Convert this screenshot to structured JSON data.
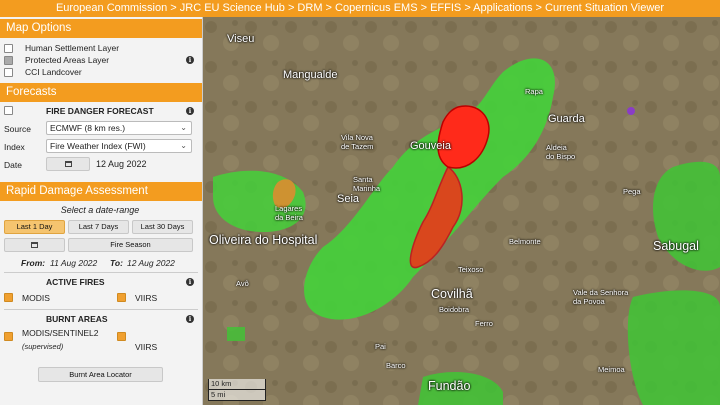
{
  "breadcrumb": "European Commission > JRC EU Science Hub > DRM > Copernicus EMS > EFFIS > Applications > Current Situation Viewer",
  "map_options": {
    "title": "Map Options",
    "layers": [
      {
        "label": "Human Settlement Layer"
      },
      {
        "label": "Protected Areas Layer"
      },
      {
        "label": "CCI Landcover"
      }
    ]
  },
  "forecasts": {
    "title": "Forecasts",
    "fire_danger_label": "FIRE DANGER FORECAST",
    "source_label": "Source",
    "source_value": "ECMWF (8 km res.)",
    "index_label": "Index",
    "index_value": "Fire Weather Index (FWI)",
    "date_label": "Date",
    "date_value": "12 Aug 2022"
  },
  "rapid": {
    "title": "Rapid Damage Assessment",
    "select_range": "Select a date-range",
    "btn_1day": "Last 1 Day",
    "btn_7days": "Last 7 Days",
    "btn_30days": "Last 30 Days",
    "btn_season": "Fire Season",
    "from_label": "From:",
    "from_value": "11 Aug 2022",
    "to_label": "To:",
    "to_value": "12 Aug 2022",
    "active_fires": "ACTIVE FIRES",
    "modis": "MODIS",
    "viirs": "VIIRS",
    "burnt_areas": "BURNT AREAS",
    "modis_sentinel": "MODIS/SENTINEL2",
    "supervised": "(supervised)",
    "viirs2": "VIIRS",
    "locator": "Burnt Area Locator"
  },
  "map_labels": {
    "viseu": "Viseu",
    "mangualde": "Mangualde",
    "vila_nova": "Vila Nova\nde Tazem",
    "gouveia": "Gouveia",
    "guarda": "Guarda",
    "santa_marinha": "Santa\nMarinha",
    "seia": "Seia",
    "aldeia": "Aldeia\ndo Bispo",
    "pega": "Pega",
    "oliveira": "Oliveira do Hospital",
    "lagares": "Lagares\nda Beira",
    "belmonte": "Belmonte",
    "sabugal": "Sabugal",
    "teixoso": "Teixoso",
    "covilha": "Covilhã",
    "boidobra": "Boidobra",
    "ferro": "Ferro",
    "avo": "Avô",
    "vale_senhora": "Vale da Senhora\nda Povoa",
    "pai": "Pai",
    "barco": "Barco",
    "meimoa": "Meimoa",
    "fundao": "Fundão",
    "rapa": "Rapa",
    "scale_km": "10 km",
    "scale_mi": "5 mi"
  },
  "colors": {
    "accent": "#f39c1f",
    "burnt": "#ff2a1a",
    "burnt_dark": "#d9471d",
    "green_area": "#44d13a"
  }
}
